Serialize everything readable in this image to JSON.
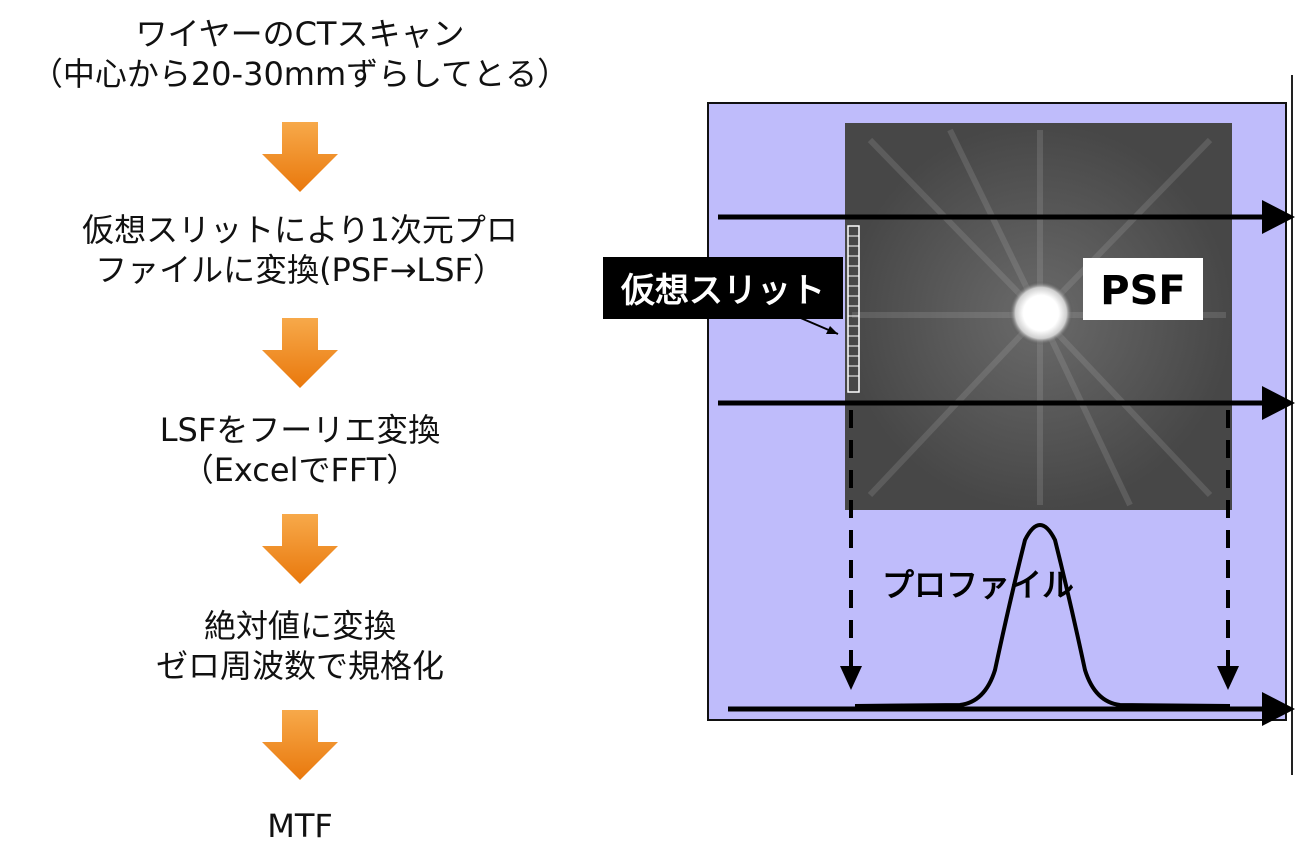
{
  "flow": {
    "steps": [
      {
        "line1": "ワイヤーのCTスキャン",
        "line2": "（中心から20-30mmずらしてとる）"
      },
      {
        "line1": "仮想スリットにより1次元プロ",
        "line2": "ファイルに変換(PSF→LSF）"
      },
      {
        "line1": "LSFをフーリエ変換",
        "line2": "（ExcelでFFT）"
      },
      {
        "line1": "絶対値に変換",
        "line2": "ゼロ周波数で規格化"
      },
      {
        "line1": "MTF",
        "line2": ""
      }
    ],
    "arrow_color": "#f08a1c"
  },
  "diagram": {
    "slit_label": "仮想スリット",
    "psf_label": "PSF",
    "profile_label": "プロファイル",
    "colors": {
      "background": "#bfbcfb",
      "image": "#4a4a4a",
      "label_bg": "#000000"
    }
  }
}
